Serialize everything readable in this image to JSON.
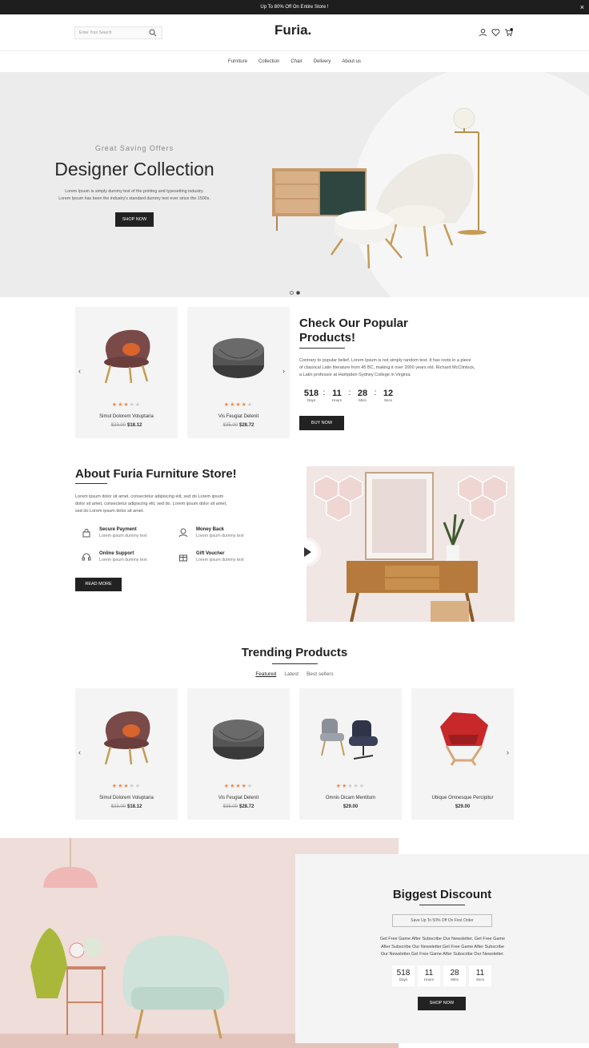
{
  "topbar": {
    "announcement": "Up To 80% Off On Entire Store !",
    "close": "×"
  },
  "header": {
    "search_placeholder": "Enter Your Search",
    "logo": "Furia.",
    "cart_count": "0"
  },
  "nav": [
    "Furniture",
    "Collection",
    "Chair",
    "Delivery",
    "About us"
  ],
  "hero": {
    "subtitle": "Great Saving Offers",
    "title": "Designer Collection",
    "desc1": "Lorem Ipsum is simply dummy text of the printing and typesetting industry.",
    "desc2": "Lorem Ipsum has been the industry's standard dummy text ever since the 1500s.",
    "cta": "SHOP NOW"
  },
  "popular": {
    "title_line1": "Check Our Popular",
    "title_line2": "Products!",
    "desc": [
      "Contrary to popular belief, Lorem Ipsum is not simply random text. It has roots in a piece",
      "of classical Latin literature from 45 BC, making it over 2000 years old. Richard McClintock,",
      "a Latin professor at Hampden-Sydney College in Virginia."
    ],
    "countdown": [
      {
        "value": "518",
        "label": "Days"
      },
      {
        "value": "11",
        "label": "Hours"
      },
      {
        "value": "28",
        "label": "Mins"
      },
      {
        "value": "12",
        "label": "Secs"
      }
    ],
    "separator": ":",
    "cta": "BUY NOW",
    "products": [
      {
        "name": "Simul Dolorem Voluptaria",
        "old_price": "$23.00",
        "price": "$18.12",
        "rating": 3
      },
      {
        "name": "Vis Feugiat Delenit",
        "old_price": "$35.00",
        "price": "$28.72",
        "rating": 4
      }
    ]
  },
  "about": {
    "title": "About Furia Furniture Store!",
    "desc": [
      "Lorem ipsum dolor sit amet, consectetur adipiscing elit, sed do Lorem ipsum",
      "dolor sit amet, consectetur adipiscing elit, sed do. Lorem ipsum dolor sit amet,",
      "sed do Lorem ipsum dolor sit amet."
    ],
    "features": [
      {
        "title": "Secure Payment",
        "desc": "Lorem ipsum dummy text",
        "icon": "lock-icon"
      },
      {
        "title": "Money Back",
        "desc": "Lorem ipsum dummy text",
        "icon": "money-back-icon"
      },
      {
        "title": "Online Support",
        "desc": "Lorem ipsum dummy text",
        "icon": "headset-icon"
      },
      {
        "title": "Gift Voucher",
        "desc": "Lorem ipsum dummy text",
        "icon": "gift-icon"
      }
    ],
    "cta": "READ MORE"
  },
  "trending": {
    "title": "Trending Products",
    "tabs": [
      "Featured",
      "Latest",
      "Best sellers"
    ],
    "products": [
      {
        "name": "Simul Dolorem Voluptaria",
        "old_price": "$23.00",
        "price": "$18.12",
        "rating": 3
      },
      {
        "name": "Vis Feugiat Delenit",
        "old_price": "$35.00",
        "price": "$28.72",
        "rating": 4
      },
      {
        "name": "Omnis Dicam Mentitum",
        "old_price": "",
        "price": "$29.00",
        "rating": 2
      },
      {
        "name": "Ubique Omnesque Percipitur",
        "old_price": "",
        "price": "$29.00",
        "rating": 0
      }
    ]
  },
  "discount": {
    "title": "Biggest Discount",
    "pill": "Save Up To 50% Off On First Order",
    "text": [
      "Get Free Game After Subscribe Our Newsletter. Get Free Game",
      "After Subscribe Our Newsletter.Get Free Game After Subscribe",
      "Our Newsletter.Get Free Game After Subscribe Our Newsletter."
    ],
    "countdown": [
      {
        "value": "518",
        "label": "Days"
      },
      {
        "value": "11",
        "label": "Hours"
      },
      {
        "value": "28",
        "label": "Mins"
      },
      {
        "value": "11",
        "label": "Secs"
      }
    ],
    "cta": "SHOP NOW"
  },
  "colors": {
    "accent": "#222222",
    "star": "#e98b4e",
    "hero_bg": "#ececec",
    "card_bg": "#f4f4f4"
  }
}
